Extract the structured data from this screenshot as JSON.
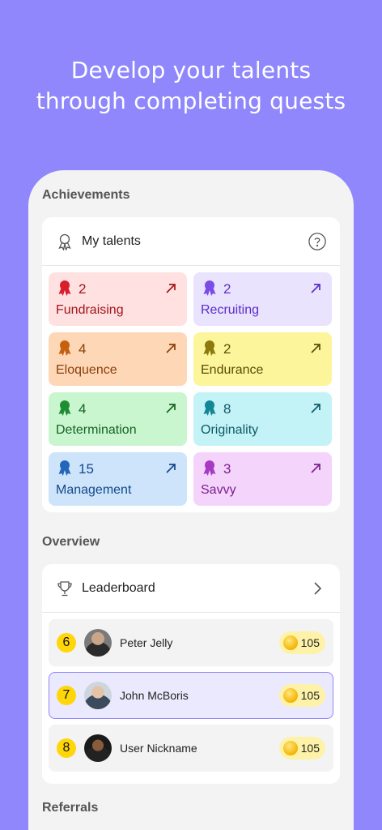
{
  "headline": {
    "line1": "Develop your talents",
    "line2": "through completing quests"
  },
  "achievements": {
    "section_title": "Achievements",
    "card_title": "My talents",
    "talents": [
      {
        "count": "2",
        "name": "Fundraising",
        "bg": "#ffe1e1",
        "fg": "#a3151b",
        "icon": "#d91f2b"
      },
      {
        "count": "2",
        "name": "Recruiting",
        "bg": "#e9e3fe",
        "fg": "#5b2cc9",
        "icon": "#7a4ce8"
      },
      {
        "count": "4",
        "name": "Eloquence",
        "bg": "#fdd7b6",
        "fg": "#8a3f0a",
        "icon": "#c4600f"
      },
      {
        "count": "2",
        "name": "Endurance",
        "bg": "#fdf59b",
        "fg": "#5a4c05",
        "icon": "#8c7a0a"
      },
      {
        "count": "4",
        "name": "Determination",
        "bg": "#c9f5cf",
        "fg": "#156524",
        "icon": "#1f8e33"
      },
      {
        "count": "8",
        "name": "Originality",
        "bg": "#c3f3f6",
        "fg": "#0d5a66",
        "icon": "#168696"
      },
      {
        "count": "15",
        "name": "Management",
        "bg": "#cde4fb",
        "fg": "#13488a",
        "icon": "#2366b8"
      },
      {
        "count": "3",
        "name": "Savvy",
        "bg": "#f4d4fb",
        "fg": "#7b1f90",
        "icon": "#a63bc2"
      }
    ]
  },
  "overview": {
    "section_title": "Overview",
    "leaderboard_title": "Leaderboard",
    "rows": [
      {
        "rank": "6",
        "name": "Peter Jelly",
        "coins": "105",
        "highlight": false
      },
      {
        "rank": "7",
        "name": "John McBoris",
        "coins": "105",
        "highlight": true
      },
      {
        "rank": "8",
        "name": "User Nickname",
        "coins": "105",
        "highlight": false
      }
    ]
  },
  "referrals": {
    "section_title": "Referrals"
  },
  "colors": {
    "background": "#8f87fb",
    "rank_badge": "#ffd60a",
    "coin_pill": "#fdf2a8"
  }
}
